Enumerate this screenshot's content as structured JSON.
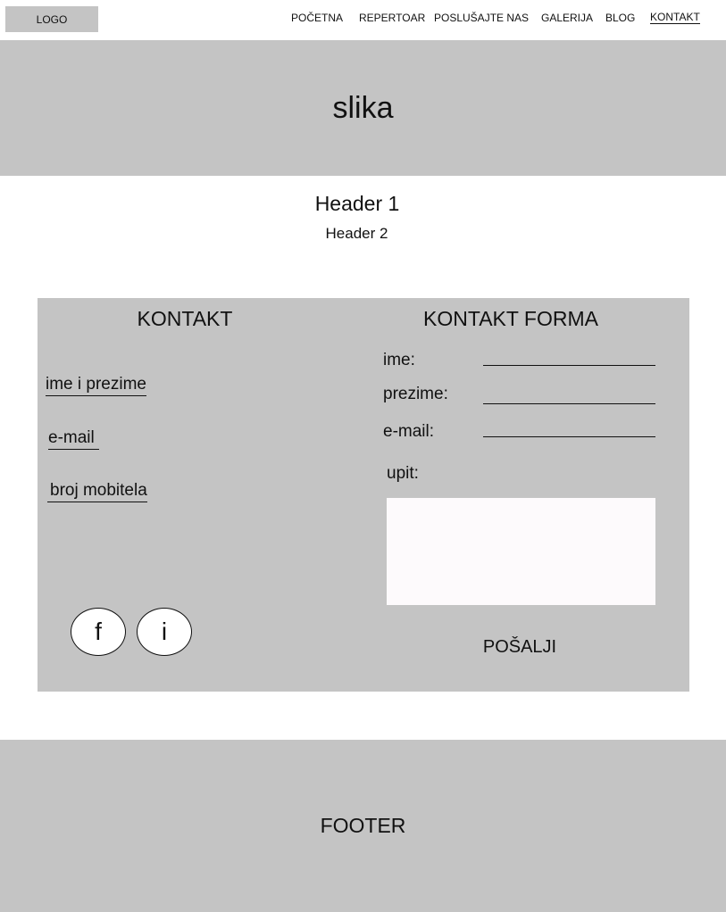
{
  "header": {
    "logo": "LOGO",
    "nav": [
      "POČETNA",
      "REPERTOAR",
      "POSLUŠAJTE NAS",
      "GALERIJA",
      "BLOG",
      "KONTAKT"
    ],
    "active_item": "KONTAKT"
  },
  "hero": {
    "text": "slika"
  },
  "headings": {
    "h1": "Header 1",
    "h2": "Header 2"
  },
  "contact": {
    "title": "KONTAKT",
    "items": [
      "ime i prezime",
      "e-mail",
      "broj mobitela"
    ],
    "social": [
      "f",
      "i"
    ]
  },
  "form": {
    "title": "KONTAKT FORMA",
    "labels": {
      "name": "ime:",
      "surname": "prezime:",
      "email": "e-mail:",
      "query": "upit:"
    },
    "values": {
      "name": "",
      "surname": "",
      "email": "",
      "query": ""
    },
    "submit_label": "POŠALJI"
  },
  "footer": {
    "text": "FOOTER"
  },
  "colors": {
    "placeholder_gray": "#c4c4c4",
    "textarea_bg": "#fdfafc",
    "text": "#111111"
  }
}
